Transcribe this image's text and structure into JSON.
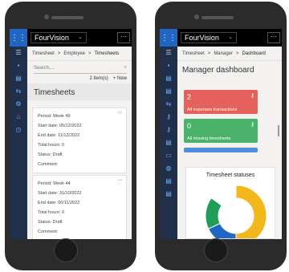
{
  "app": {
    "name": "FourVision",
    "more": "···",
    "waffle_icon": "grid-icon"
  },
  "left": {
    "breadcrumb": [
      "Timesheet",
      "Employee",
      "Timesheets"
    ],
    "breadcrumb_sep": ">",
    "search_placeholder": "Search....",
    "item_count": "2 item(s)",
    "new_label": "+ New",
    "section_title": "Timesheets",
    "cards": [
      {
        "period": "Period:  Week 49",
        "start": "Start date:  05/12/2022",
        "end": "End date:  11/12/2022",
        "hours": "Total hours:  0",
        "status": "Status:  Draft",
        "comment": "Comment:"
      },
      {
        "period": "Period:  Week 44",
        "start": "Start date:  31/10/2022",
        "end": "End date:  06/11/2022",
        "hours": "Total hours:  0",
        "status": "Status:  Draft",
        "comment": "Comment:"
      }
    ]
  },
  "right": {
    "breadcrumb": [
      "Timesheet",
      "Manager",
      "Dashboard"
    ],
    "breadcrumb_sep": ">",
    "title": "Manager dashboard",
    "tiles": [
      {
        "num": "2",
        "label": "All expenses transactions",
        "color": "#e4625b"
      },
      {
        "num": "0",
        "label": "All missing timesheets",
        "color": "#4ab26b"
      }
    ],
    "statuses_title": "Timesheet statuses",
    "donut": [
      {
        "value": 0.5,
        "color": "#f2b71a"
      },
      {
        "value": 0.18,
        "color": "#2266c4"
      },
      {
        "value": 0.17,
        "color": "#1f9e57"
      },
      {
        "value": 0.15,
        "color": "#ffffff"
      }
    ]
  }
}
